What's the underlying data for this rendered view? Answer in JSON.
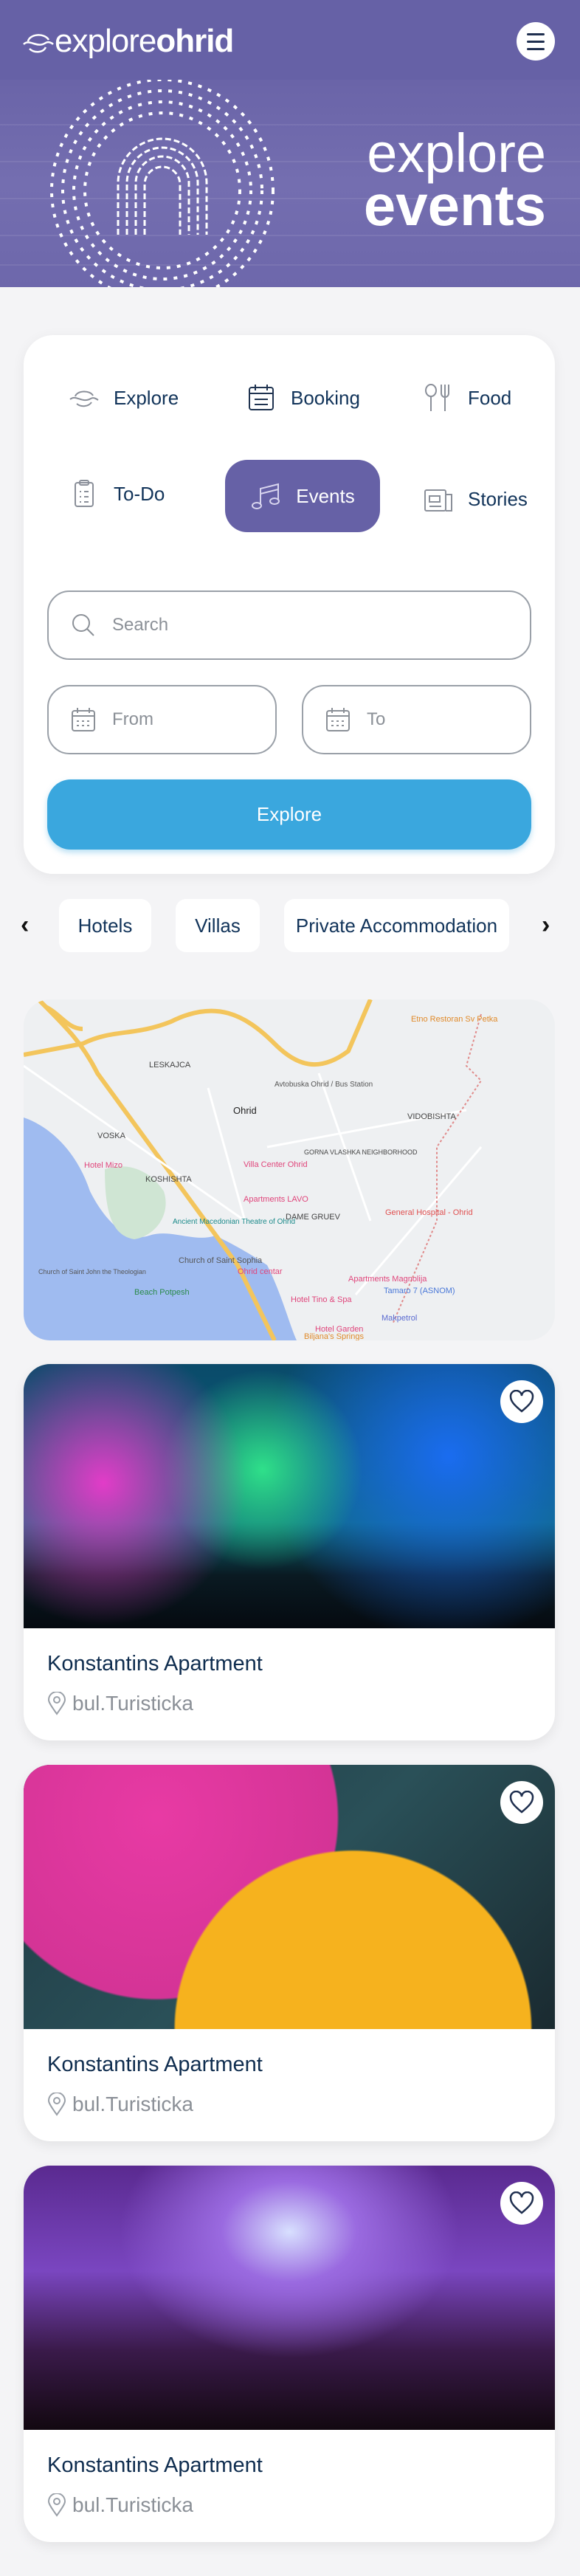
{
  "header": {
    "logo_light": "explore",
    "logo_bold": "ohrid",
    "menu_icon": "hamburger-icon",
    "bg_color": "#6661a6"
  },
  "hero": {
    "line1": "explore",
    "line2": "events"
  },
  "nav": {
    "items": [
      {
        "label": "Explore",
        "icon": "explore-wave-icon"
      },
      {
        "label": "Booking",
        "icon": "calendar-list-icon"
      },
      {
        "label": "Food",
        "icon": "fork-spoon-icon"
      },
      {
        "label": "To-Do",
        "icon": "clipboard-icon"
      },
      {
        "label": "Events",
        "icon": "music-note-icon",
        "active": true
      },
      {
        "label": "Stories",
        "icon": "newspaper-icon"
      }
    ],
    "active_color": "#6661a6"
  },
  "search": {
    "placeholder": "Search",
    "from_placeholder": "From",
    "to_placeholder": "To",
    "button": "Explore",
    "button_color": "#3aa7de"
  },
  "filters": {
    "chips": [
      "Hotels",
      "Villas",
      "Private Accommodation"
    ]
  },
  "map": {
    "labels": [
      "LESKAJCA",
      "Ohrid",
      "VOSKA",
      "KOSHISHTA",
      "VIDOBISHTA",
      "GORNA VLASHKA NEIGHBORHOOD",
      "DAME GRUEV",
      "Hotel Mizo",
      "Villa Center Ohrid",
      "Apartments LAVO",
      "Ancient Macedonian Theatre of Ohrid",
      "Church of Saint Sophia",
      "Church of Saint John the Theologian",
      "Beach Potpesh",
      "Ohrid centar",
      "Apartments Magnolija",
      "Hotel Tino & Spa",
      "Tamaro 7 (ASNOM)",
      "General Hospital - Ohrid",
      "Avtobuska Ohrid / Bus Station",
      "Etno Restoran Sv Petka",
      "Hotel Garden",
      "Makpetrol",
      "Biljana's Springs"
    ]
  },
  "cards": [
    {
      "title": "Konstantins Apartment",
      "location": "bul.Turisticka"
    },
    {
      "title": "Konstantins Apartment",
      "location": "bul.Turisticka"
    },
    {
      "title": "Konstantins Apartment",
      "location": "bul.Turisticka"
    }
  ]
}
